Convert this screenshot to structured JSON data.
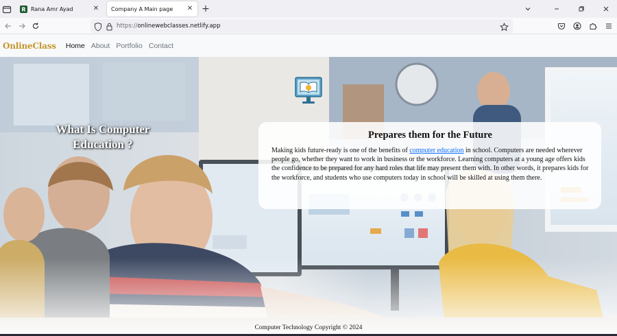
{
  "browser": {
    "tabs": [
      {
        "title": "Rana Amr Ayad",
        "active": false,
        "favicon": "green-r-favicon"
      },
      {
        "title": "Company A Main page",
        "active": true
      }
    ],
    "new_tab_label": "+",
    "close_glyph": "✕",
    "url_protocol": "https://",
    "url_host": "onlinewebclasses.netlify.app",
    "icons": [
      "tab-list-icon",
      "back-arrow-icon",
      "forward-arrow-icon",
      "reload-icon",
      "shield-icon",
      "lock-icon",
      "star-icon",
      "pocket-icon",
      "account-icon",
      "extensions-icon",
      "menu-icon",
      "chevron-down-icon",
      "minimize-icon",
      "restore-icon",
      "close-window-icon"
    ]
  },
  "site": {
    "brand": "OnlineClass",
    "nav": [
      {
        "label": "Home",
        "active": true
      },
      {
        "label": "About",
        "active": false
      },
      {
        "label": "Portfolio",
        "active": false
      },
      {
        "label": "Contact",
        "active": false
      }
    ],
    "hero_heading_line1": "What Is Computer",
    "hero_heading_line2": "Education ?",
    "card": {
      "title": "Prepares them for the Future",
      "text_before_link": "Making kids future-ready is one of the benefits of ",
      "link_text": "computer education",
      "text_after_link": " in school. Computers are needed wherever people go, whether they want to work in business or the workforce. Learning computers at a young age offers kids the confidence to be prepared for any hard roles that life may present them with. In other words, it prepares kids for the workforce, and students who use computers today in school will be skilled at using them there."
    },
    "footer": "Computer Technology Copyright © 2024"
  },
  "colors": {
    "brand": "#c4962c",
    "link": "#0d6efd",
    "tab_bar": "#f0f0f4"
  }
}
